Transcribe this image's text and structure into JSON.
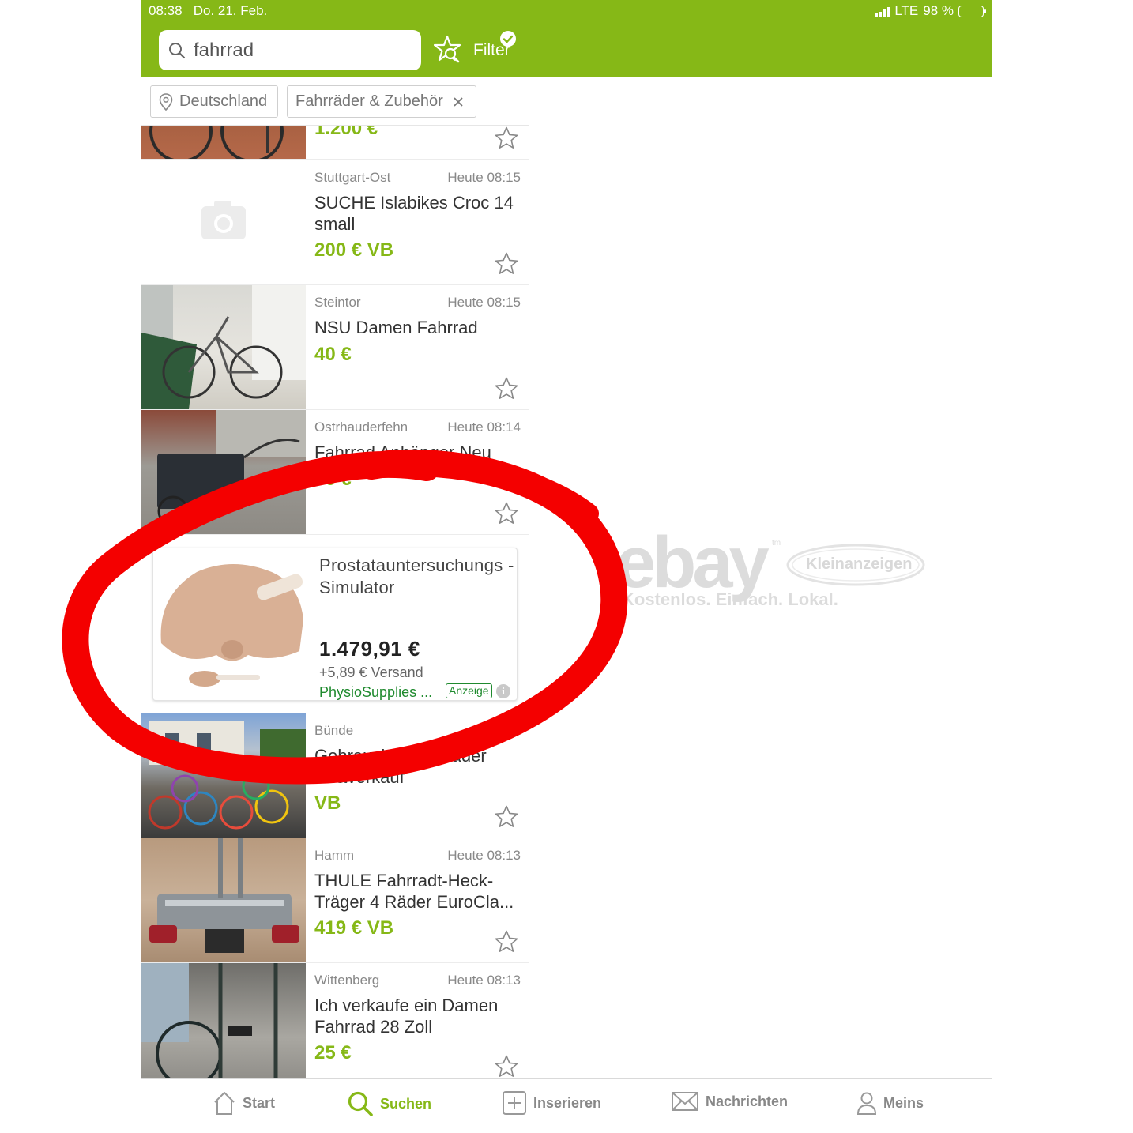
{
  "status_bar": {
    "time": "08:38",
    "date": "Do. 21. Feb.",
    "network": "LTE",
    "battery": "98 %"
  },
  "search": {
    "query": "fahrrad",
    "filter_label": "Filter"
  },
  "chips": {
    "location": "Deutschland",
    "category": "Fahrräder & Zubehör"
  },
  "listings": [
    {
      "location": "",
      "time": "",
      "title": "",
      "price": "1.200 €",
      "thumb": "bike-brick"
    },
    {
      "location": "Stuttgart-Ost",
      "time": "Heute 08:15",
      "title": "SUCHE Islabikes Croc 14 small",
      "price": "200 € VB",
      "thumb": "camera-placeholder"
    },
    {
      "location": "Steintor",
      "time": "Heute 08:15",
      "title": "NSU Damen Fahrrad",
      "price": "40 €",
      "thumb": "bike-tiles"
    },
    {
      "location": "Ostrhauderfehn",
      "time": "Heute 08:14",
      "title": "Fahrrad Anhänger Neu",
      "price": "70 €",
      "thumb": "trailer"
    }
  ],
  "ad": {
    "title": "Prostatauntersuchungs -Simulator",
    "price": "1.479,91 €",
    "shipping": "+5,89 € Versand",
    "seller": "PhysioSupplies ...",
    "badge": "Anzeige",
    "info": "i"
  },
  "listings_after": [
    {
      "location": "Bünde",
      "time": "Heute",
      "title": "Gebrauchte Fahrräder An&verkauf",
      "price": "VB",
      "thumb": "many-bikes"
    },
    {
      "location": "Hamm",
      "time": "Heute 08:13",
      "title": "THULE Fahrradt-Heck-Träger 4 Räder EuroCla...",
      "price": "419 € VB",
      "thumb": "bike-rack"
    },
    {
      "location": "Wittenberg",
      "time": "Heute 08:13",
      "title": "Ich verkaufe ein Damen Fahrrad 28 Zoll",
      "price": "25 €",
      "thumb": "bike-dark"
    }
  ],
  "brand": {
    "logo_text": "ebay",
    "sub_logo": "Kleinanzeigen",
    "tm": "tm",
    "tagline": "Kostenlos. Einfach. Lokal."
  },
  "tabs": [
    {
      "label": "Start",
      "icon": "home-icon"
    },
    {
      "label": "Suchen",
      "icon": "search-icon",
      "active": true
    },
    {
      "label": "Inserieren",
      "icon": "plus-square-icon"
    },
    {
      "label": "Nachrichten",
      "icon": "envelope-icon"
    },
    {
      "label": "Meins",
      "icon": "user-icon"
    }
  ],
  "colors": {
    "brand_green": "#86b817",
    "annotation_red": "#f40000",
    "seller_green": "#1f8a2e"
  }
}
